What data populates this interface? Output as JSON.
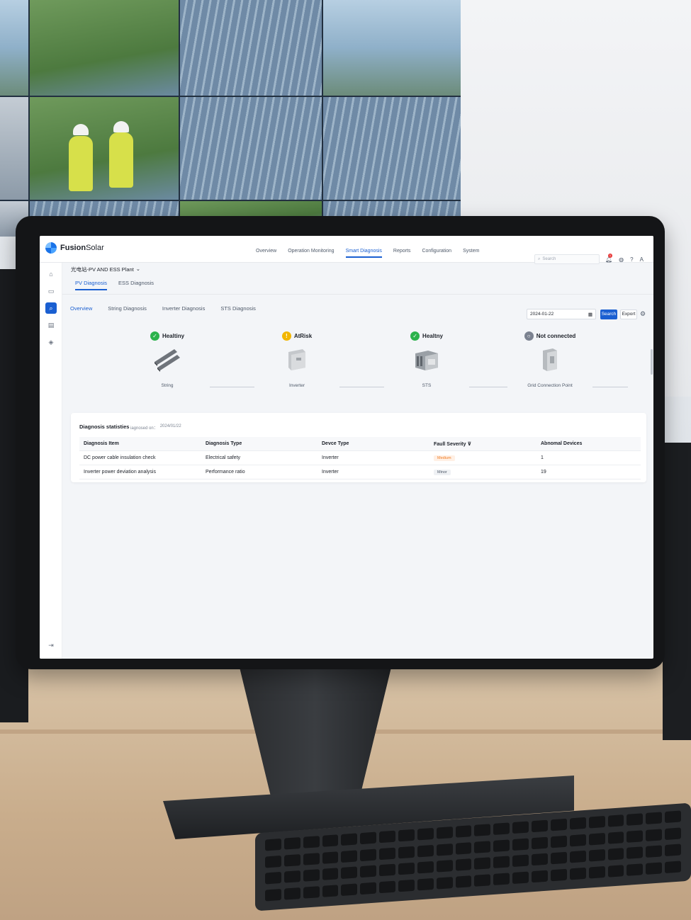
{
  "app": {
    "brand_bold": "Fusion",
    "brand_rest": "Solar"
  },
  "nav": {
    "items": [
      {
        "label": "Overview"
      },
      {
        "label": "Operation Monitoring"
      },
      {
        "label": "Smart Diagnosis"
      },
      {
        "label": "Reports"
      },
      {
        "label": "Configuration"
      },
      {
        "label": "System"
      }
    ],
    "active": "Smart Diagnosis"
  },
  "header": {
    "search_placeholder": "Search",
    "notification_count": "1",
    "user_initial": "A"
  },
  "sidebar": {
    "icons": [
      "home-icon",
      "monitor-icon",
      "diagnosis-icon",
      "clipboard-icon",
      "layers-icon"
    ],
    "collapse_icon": "collapse-icon"
  },
  "plant": {
    "name": "光电站-PV AND ESS Plant",
    "chevron": "⌄"
  },
  "subtabs": [
    {
      "label": "PV Diagnosis"
    },
    {
      "label": "ESS Diagnosis"
    }
  ],
  "innertabs": [
    {
      "label": "Overview"
    },
    {
      "label": "String Diagnosis"
    },
    {
      "label": "Inverter Diagnosis"
    },
    {
      "label": "STS Diagnosis"
    }
  ],
  "toolbar": {
    "date": "2024-01-22",
    "search_label": "Search",
    "export_label": "Export"
  },
  "diagram": {
    "nodes": [
      {
        "status": "Healtiny",
        "status_icon": "check-icon",
        "label": "String",
        "device_icon": "string-icon",
        "status_color": "#2bb24c"
      },
      {
        "status": "AtRisk",
        "status_icon": "warning-icon",
        "label": "Inverter",
        "device_icon": "inverter-icon",
        "status_color": "#f2b600"
      },
      {
        "status": "Healtny",
        "status_icon": "check-icon",
        "label": "STS",
        "device_icon": "sts-icon",
        "status_color": "#2bb24c"
      },
      {
        "status": "Not connected",
        "status_icon": "disconnected-icon",
        "label": "Grid Connection Point",
        "device_icon": "grid-icon",
        "status_color": "#7b8290"
      }
    ]
  },
  "stats": {
    "title": "Diagnosis statisties",
    "diagnosed_label": "iagnosed on：",
    "diagnosed_date": "2024/01/22",
    "columns": [
      "Diagnosis Item",
      "Diagnosis Type",
      "Devce Type",
      "Faull Severity",
      "Abnomal Devices"
    ],
    "rows": [
      {
        "item": "DC power cable insulation check",
        "type": "Electrical safety",
        "device": "Inverter",
        "severity": "Medium",
        "abnormal": "1"
      },
      {
        "item": "Inverter power deviation analysis",
        "type": "Performance ratio",
        "device": "Inverter",
        "severity": "Minor",
        "abnormal": "19"
      }
    ]
  },
  "colors": {
    "accent": "#1a5fd1",
    "healthy": "#2bb24c",
    "at_risk": "#f2b600",
    "disconnected": "#7b8290",
    "medium": "#f07b22"
  }
}
